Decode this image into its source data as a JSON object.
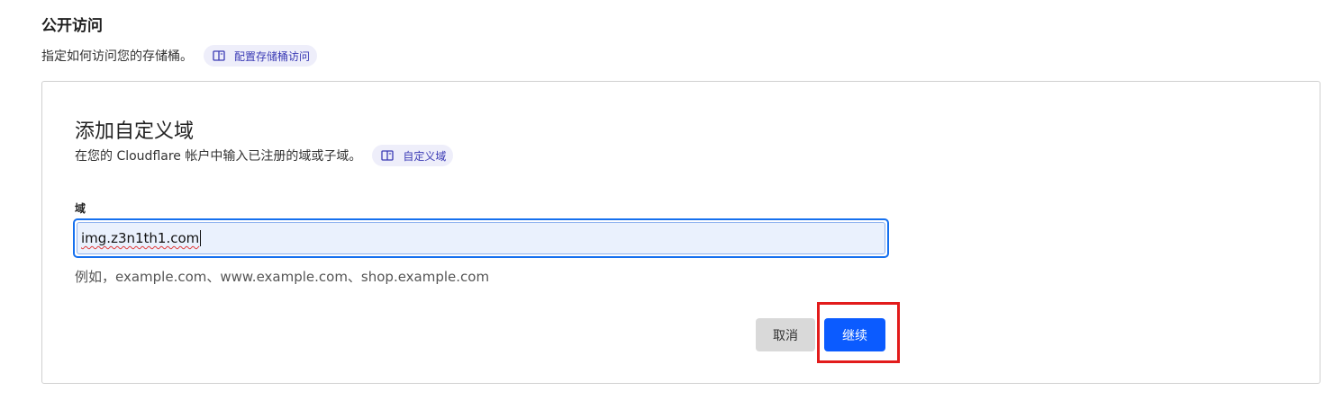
{
  "section": {
    "title": "公开访问",
    "description": "指定如何访问您的存储桶。",
    "doc_link": {
      "icon": "book-icon",
      "label": "配置存储桶访问"
    }
  },
  "card": {
    "title": "添加自定义域",
    "description": "在您的 Cloudflare 帐户中输入已注册的域或子域。",
    "doc_link": {
      "icon": "book-icon",
      "label": "自定义域"
    },
    "field": {
      "label": "域",
      "value": "img.z3n1th1.com",
      "hint": "例如，example.com、www.example.com、shop.example.com"
    },
    "buttons": {
      "cancel": "取消",
      "continue": "继续"
    }
  },
  "colors": {
    "accent": "#0b5bff",
    "pill_bg": "#eeeefa",
    "pill_text": "#3b3bb5",
    "focus_border": "#1570ef",
    "highlight": "#e21b1b"
  }
}
